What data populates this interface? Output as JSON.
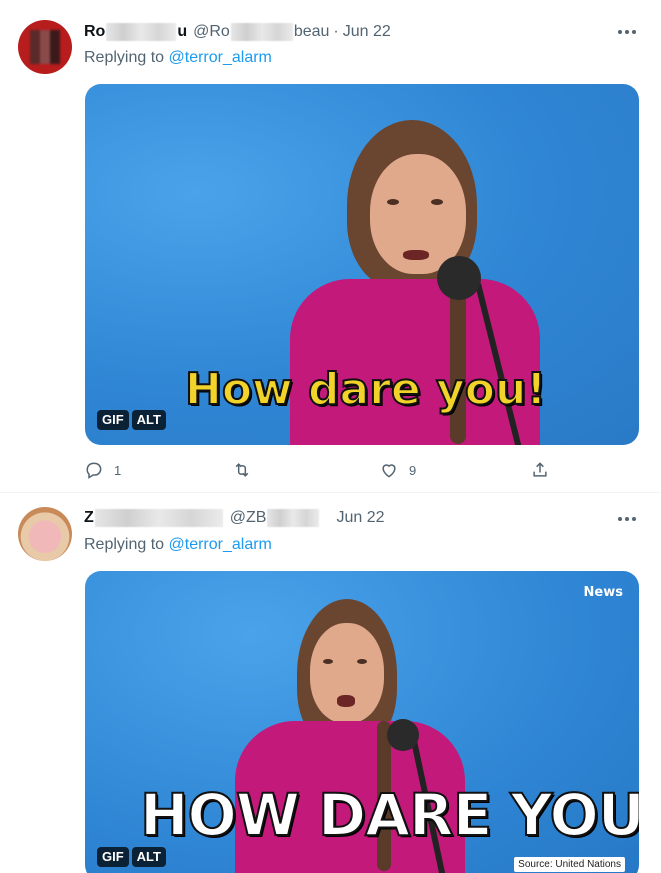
{
  "tweets": [
    {
      "name_start": "Ro",
      "name_end": "u",
      "handle_start": "@Ro",
      "handle_end": "beau",
      "dot": "·",
      "date": "Jun 22",
      "replying_prefix": "Replying to ",
      "replying_mention": "@terror_alarm",
      "media": {
        "caption": "How dare you!",
        "gif_label": "GIF",
        "alt_label": "ALT"
      },
      "actions": {
        "reply_count": "1",
        "retweet_count": "",
        "like_count": "9"
      }
    },
    {
      "name_start": "Z",
      "name_end": "",
      "handle_start": "@ZB",
      "handle_end": "",
      "dot": "",
      "date": "Jun 22",
      "replying_prefix": "Replying to ",
      "replying_mention": "@terror_alarm",
      "media": {
        "caption": "HOW DARE YOU",
        "gif_label": "GIF",
        "alt_label": "ALT",
        "watermark": "News",
        "source": "Source: United Nations"
      }
    }
  ],
  "icons": [
    "more-icon",
    "reply-icon",
    "retweet-icon",
    "like-icon",
    "share-icon"
  ],
  "colors": {
    "link": "#1d9bf0",
    "muted": "#536471",
    "text": "#0f1419"
  }
}
